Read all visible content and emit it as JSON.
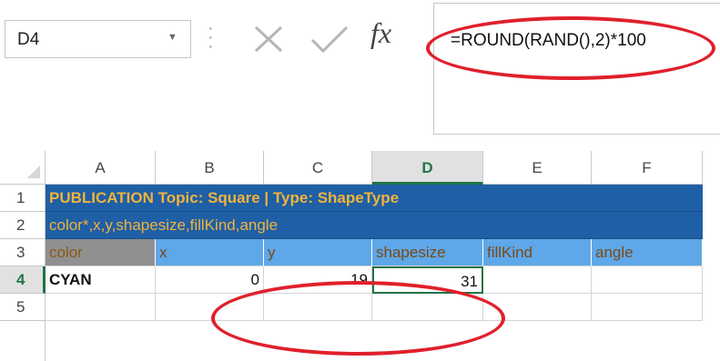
{
  "formula_bar": {
    "name_box": "D4",
    "name_box_arrow_icon": "chevron-down-icon",
    "cancel_icon": "close-icon",
    "enter_icon": "checkmark-icon",
    "fx_label": "fx",
    "formula": "=ROUND(RAND(),2)*100"
  },
  "columns": [
    "A",
    "B",
    "C",
    "D",
    "E",
    "F"
  ],
  "active_column": "D",
  "rows": [
    "1",
    "2",
    "3",
    "4",
    "5"
  ],
  "active_row": "4",
  "sheet": {
    "row1": "PUBLICATION Topic: Square | Type: ShapeType",
    "row2": "color*,x,y,shapesize,fillKind,angle",
    "row3": [
      "color",
      "x",
      "y",
      "shapesize",
      "fillKind",
      "angle"
    ],
    "row4": [
      "CYAN",
      "0",
      "19",
      "31",
      "",
      ""
    ],
    "row5": [
      "",
      "",
      "",
      "",
      "",
      ""
    ]
  },
  "colors": {
    "band_blue": "#1f5fa6",
    "band_text": "#f0b33c",
    "header_light_blue": "#5ea7e8",
    "header_gray": "#909090",
    "annotation_red": "#e0202c",
    "selection_green": "#217346"
  }
}
